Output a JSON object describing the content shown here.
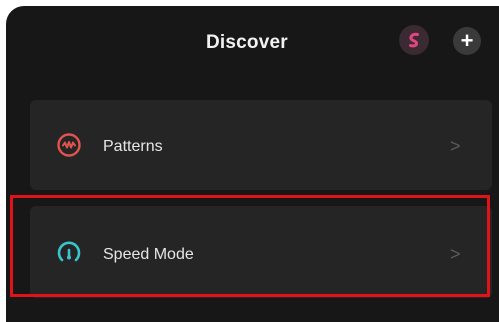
{
  "header": {
    "title": "Discover",
    "device_icon": "toy-device-icon",
    "add_icon": "plus-icon",
    "add_label": "+"
  },
  "cards": [
    {
      "label": "Patterns",
      "icon": "waveform-icon",
      "icon_color": "#e2544f",
      "chevron": ">"
    },
    {
      "label": "Speed Mode",
      "icon": "speedometer-icon",
      "icon_color": "#38c6cc",
      "chevron": ">"
    }
  ],
  "colors": {
    "background": "#171717",
    "card": "#252525",
    "accent_pink": "#e2467e",
    "highlight_border": "#e0131a"
  }
}
